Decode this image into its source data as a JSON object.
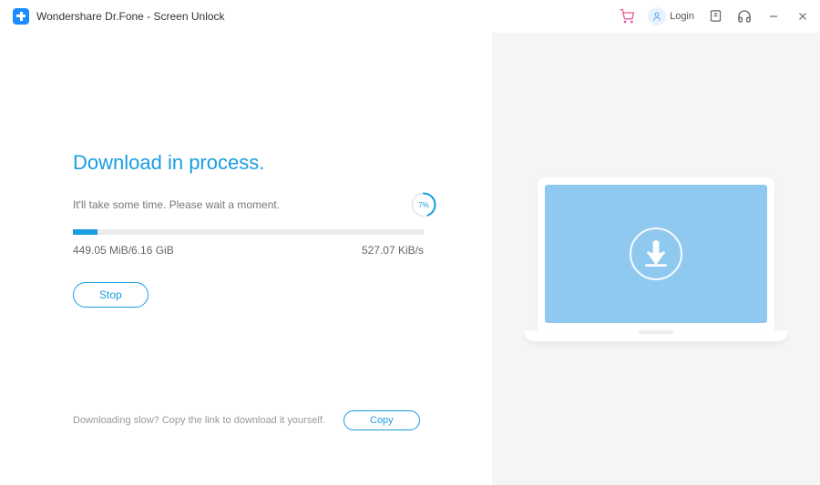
{
  "titlebar": {
    "app_title": "Wondershare Dr.Fone - Screen Unlock",
    "login_label": "Login"
  },
  "main": {
    "heading": "Download in process.",
    "wait_message": "It'll take some time. Please wait a moment.",
    "percent_label": "7%",
    "progress_percent": 7,
    "downloaded_stat": "449.05 MiB/6.16 GiB",
    "speed_stat": "527.07 KiB/s",
    "stop_label": "Stop"
  },
  "footer": {
    "message": "Downloading slow? Copy the link to download it yourself.",
    "copy_label": "Copy"
  },
  "colors": {
    "accent": "#1a9de0",
    "illustration_bg": "#8fc9ef"
  }
}
